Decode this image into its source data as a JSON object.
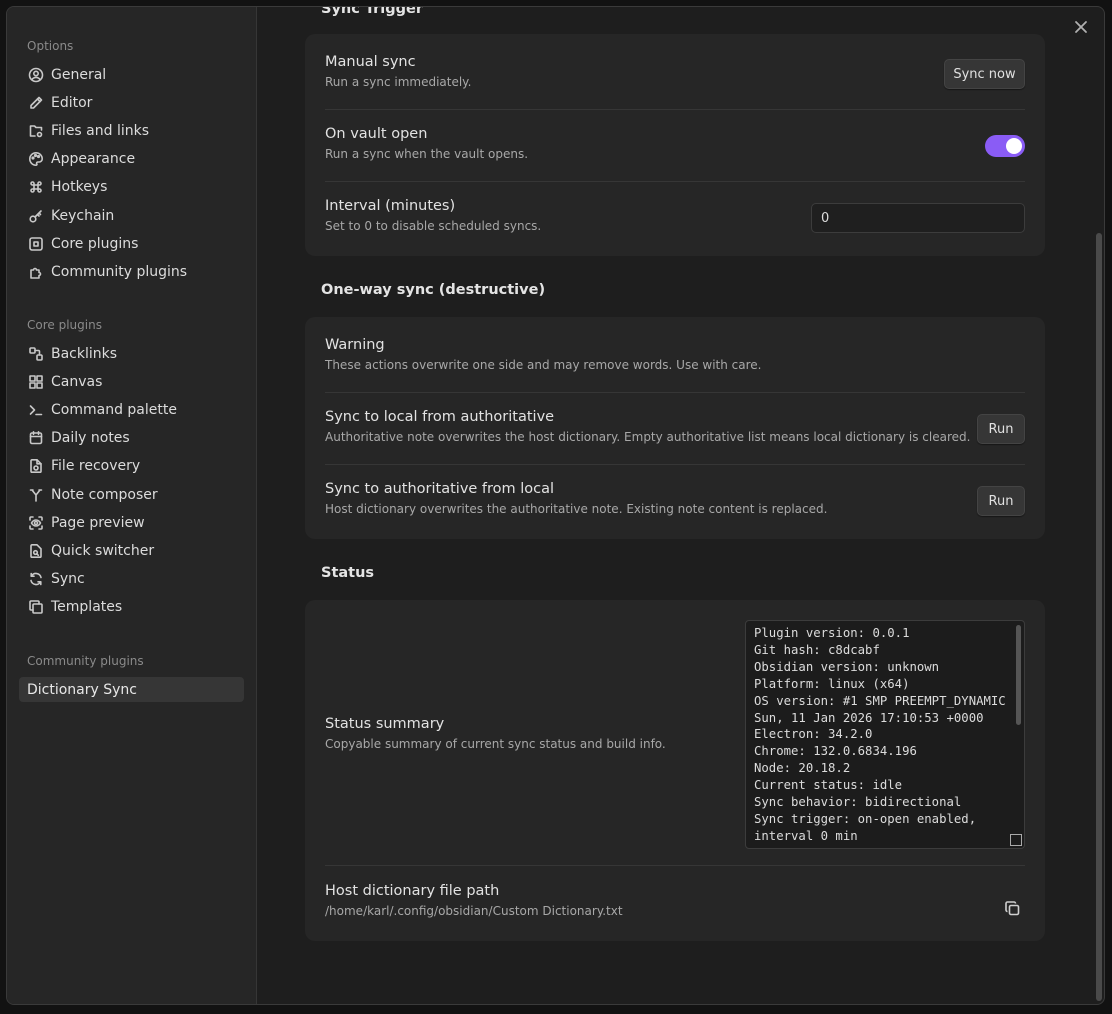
{
  "sidebar": {
    "options_title": "Options",
    "options": [
      {
        "label": "General",
        "icon": "user-circle-icon"
      },
      {
        "label": "Editor",
        "icon": "pencil-icon"
      },
      {
        "label": "Files and links",
        "icon": "folder-cog-icon"
      },
      {
        "label": "Appearance",
        "icon": "palette-icon"
      },
      {
        "label": "Hotkeys",
        "icon": "command-icon"
      },
      {
        "label": "Keychain",
        "icon": "key-icon"
      },
      {
        "label": "Core plugins",
        "icon": "plug-icon"
      },
      {
        "label": "Community plugins",
        "icon": "puzzle-icon"
      }
    ],
    "core_title": "Core plugins",
    "core": [
      {
        "label": "Backlinks",
        "icon": "backlinks-icon"
      },
      {
        "label": "Canvas",
        "icon": "canvas-icon"
      },
      {
        "label": "Command palette",
        "icon": "terminal-icon"
      },
      {
        "label": "Daily notes",
        "icon": "calendar-icon"
      },
      {
        "label": "File recovery",
        "icon": "file-recovery-icon"
      },
      {
        "label": "Note composer",
        "icon": "merge-icon"
      },
      {
        "label": "Page preview",
        "icon": "scan-eye-icon"
      },
      {
        "label": "Quick switcher",
        "icon": "file-search-icon"
      },
      {
        "label": "Sync",
        "icon": "refresh-icon"
      },
      {
        "label": "Templates",
        "icon": "templates-icon"
      }
    ],
    "community_title": "Community plugins",
    "community": [
      {
        "label": "Dictionary Sync",
        "active": true
      }
    ]
  },
  "sync_trigger": {
    "heading": "Sync Trigger",
    "manual": {
      "title": "Manual sync",
      "desc": "Run a sync immediately.",
      "button": "Sync now"
    },
    "vault_open": {
      "title": "On vault open",
      "desc": "Run a sync when the vault opens.",
      "enabled": true
    },
    "interval": {
      "title": "Interval (minutes)",
      "desc": "Set to 0 to disable scheduled syncs.",
      "value": "0"
    }
  },
  "one_way": {
    "heading": "One-way sync (destructive)",
    "warning": {
      "title": "Warning",
      "desc": "These actions overwrite one side and may remove words. Use with care."
    },
    "to_local": {
      "title": "Sync to local from authoritative",
      "desc": "Authoritative note overwrites the host dictionary. Empty authoritative list means local dictionary is cleared.",
      "button": "Run"
    },
    "to_auth": {
      "title": "Sync to authoritative from local",
      "desc": "Host dictionary overwrites the authoritative note. Existing note content is replaced.",
      "button": "Run"
    }
  },
  "status": {
    "heading": "Status",
    "summary": {
      "title": "Status summary",
      "desc": "Copyable summary of current sync status and build info.",
      "text": "Plugin version: 0.0.1\nGit hash: c8dcabf\nObsidian version: unknown\nPlatform: linux (x64)\nOS version: #1 SMP PREEMPT_DYNAMIC Sun, 11 Jan 2026 17:10:53 +0000\nElectron: 34.2.0\nChrome: 132.0.6834.196\nNode: 20.18.2\nCurrent status: idle\nSync behavior: bidirectional\nSync trigger: on-open enabled, interval 0 min"
    },
    "path": {
      "title": "Host dictionary file path",
      "desc": "/home/karl/.config/obsidian/Custom Dictionary.txt"
    }
  },
  "colors": {
    "accent": "#8a5cf5",
    "background": "#1e1e1e",
    "card": "#262626"
  }
}
